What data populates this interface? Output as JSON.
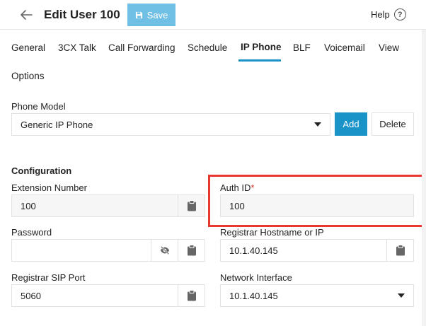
{
  "header": {
    "title": "Edit User 100",
    "save_label": "Save",
    "help_label": "Help"
  },
  "tabs": [
    {
      "label": "General"
    },
    {
      "label": "3CX Talk"
    },
    {
      "label": "Call Forwarding"
    },
    {
      "label": "Schedule"
    },
    {
      "label": "IP Phone",
      "active": true
    },
    {
      "label": "BLF"
    },
    {
      "label": "Voicemail"
    },
    {
      "label": "View"
    },
    {
      "label": "Options"
    }
  ],
  "phone_model": {
    "label": "Phone Model",
    "value": "Generic IP Phone",
    "add_label": "Add",
    "delete_label": "Delete"
  },
  "configuration": {
    "title": "Configuration",
    "extension_number": {
      "label": "Extension Number",
      "value": "100"
    },
    "auth_id": {
      "label": "Auth ID",
      "required_mark": "*",
      "value": "100"
    },
    "password": {
      "label": "Password",
      "value": ""
    },
    "registrar_hostname": {
      "label": "Registrar Hostname or IP",
      "value": "10.1.40.145"
    },
    "registrar_sip_port": {
      "label": "Registrar SIP Port",
      "value": "5060"
    },
    "network_interface": {
      "label": "Network Interface",
      "value": "10.1.40.145"
    }
  },
  "colors": {
    "primary": "#1a93c9",
    "save_button": "#6fc0e4",
    "highlight": "#e8382f"
  },
  "icons": {
    "back": "arrow-left-icon",
    "save": "floppy-disk-icon",
    "help": "question-circle-icon",
    "copy": "clipboard-icon",
    "visibility": "eye-slash-icon"
  }
}
